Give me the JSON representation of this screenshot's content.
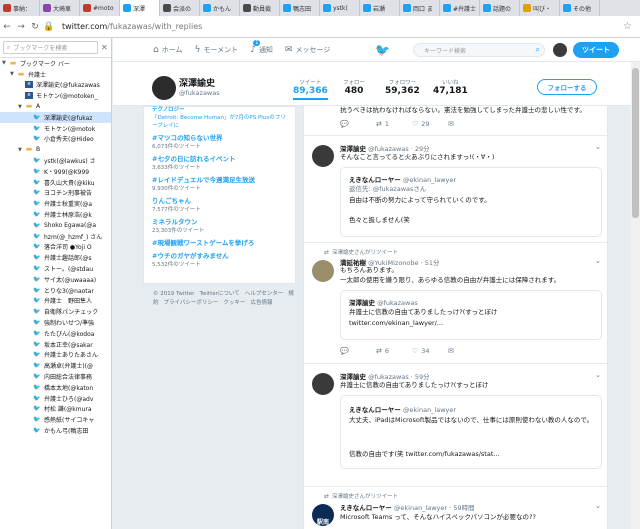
{
  "browser": {
    "tabs": [
      {
        "label": "事納：",
        "color": "#c0392b",
        "active": false
      },
      {
        "label": "大崎車",
        "color": "#8e44ad",
        "active": false
      },
      {
        "label": "#moto",
        "color": "#c0392b",
        "active": false
      },
      {
        "label": "深澤",
        "color": "#1da1f2",
        "active": true
      },
      {
        "label": "会派の",
        "color": "#4a4a4a",
        "active": false
      },
      {
        "label": "かもん",
        "color": "#1da1f2",
        "active": false
      },
      {
        "label": "動員裁",
        "color": "#4a4a4a",
        "active": false
      },
      {
        "label": "鴨志田",
        "color": "#1da1f2",
        "active": false
      },
      {
        "label": "ystk(",
        "color": "#1da1f2",
        "active": false
      },
      {
        "label": "岩瀬",
        "color": "#1da1f2",
        "active": false
      },
      {
        "label": "岡口 ま",
        "color": "#1da1f2",
        "active": false
      },
      {
        "label": "#弁護士",
        "color": "#1da1f2",
        "active": false
      },
      {
        "label": "話題の",
        "color": "#1da1f2",
        "active": false
      },
      {
        "label": "叫び・",
        "color": "#e0a000",
        "active": false
      },
      {
        "label": "その他",
        "color": "#1da1f2",
        "active": false
      }
    ],
    "url_domain": "twitter.com",
    "url_path": "/fukazawas/with_replies"
  },
  "sidebar": {
    "search_placeholder": "ブックマークを検索",
    "items": [
      {
        "label": "ブックマーク バー",
        "type": "folder",
        "indent": 0,
        "exp": "▼"
      },
      {
        "label": "弁護士",
        "type": "folder",
        "indent": 1,
        "exp": "▼"
      },
      {
        "label": "深澤諭史(@fukazawas",
        "type": "e",
        "indent": 2,
        "exp": ""
      },
      {
        "label": "モトケン(@motoken_",
        "type": "e",
        "indent": 2,
        "exp": ""
      },
      {
        "label": "A",
        "type": "folder",
        "indent": 2,
        "exp": "▼"
      },
      {
        "label": "深澤諭史(@fukaz",
        "type": "bird",
        "indent": 3,
        "exp": "",
        "selected": true
      },
      {
        "label": "モトケン(@motok",
        "type": "bird",
        "indent": 3,
        "exp": ""
      },
      {
        "label": "小倉秀夫(@Hideo",
        "type": "bird",
        "indent": 3,
        "exp": ""
      },
      {
        "label": "B",
        "type": "folder",
        "indent": 2,
        "exp": "▼"
      },
      {
        "label": "ystk(@lawkus) さ",
        "type": "bird",
        "indent": 3,
        "exp": ""
      },
      {
        "label": "K・999(@K999",
        "type": "bird",
        "indent": 3,
        "exp": ""
      },
      {
        "label": "喜久山大貴(@kiku",
        "type": "bird",
        "indent": 3,
        "exp": ""
      },
      {
        "label": "ヨコチン刑事被告",
        "type": "bird",
        "indent": 3,
        "exp": ""
      },
      {
        "label": "弁護士秋重実(@a",
        "type": "bird",
        "indent": 3,
        "exp": ""
      },
      {
        "label": "弁護士林原浩(@k",
        "type": "bird",
        "indent": 3,
        "exp": ""
      },
      {
        "label": "Shoko Egawa(@a",
        "type": "bird",
        "indent": 3,
        "exp": ""
      },
      {
        "label": "hzm(@_hzmf_) さん",
        "type": "bird",
        "indent": 3,
        "exp": ""
      },
      {
        "label": "落合洋司 ●Yoji O",
        "type": "bird",
        "indent": 3,
        "exp": ""
      },
      {
        "label": "弁護士趣話郎(@s",
        "type": "bird",
        "indent": 3,
        "exp": ""
      },
      {
        "label": "ストー。(@stdau",
        "type": "bird",
        "indent": 3,
        "exp": ""
      },
      {
        "label": "サイ太(@uwaaaa)",
        "type": "bird",
        "indent": 3,
        "exp": ""
      },
      {
        "label": "とりな3(@naotar",
        "type": "bird",
        "indent": 3,
        "exp": ""
      },
      {
        "label": "弁護士　野田隼人",
        "type": "bird",
        "indent": 3,
        "exp": ""
      },
      {
        "label": "自衛隊パンチェック",
        "type": "bird",
        "indent": 3,
        "exp": ""
      },
      {
        "label": "強制わいせつ/準強",
        "type": "bird",
        "indent": 3,
        "exp": ""
      },
      {
        "label": "たたびん(@kodoa",
        "type": "bird",
        "indent": 3,
        "exp": ""
      },
      {
        "label": "坂本正幸(@sakar",
        "type": "bird",
        "indent": 3,
        "exp": ""
      },
      {
        "label": "弁護士ありたあさん",
        "type": "bird",
        "indent": 3,
        "exp": ""
      },
      {
        "label": "高瀬卓(弁護士)(@",
        "type": "bird",
        "indent": 3,
        "exp": ""
      },
      {
        "label": "内田総合法律事務",
        "type": "bird",
        "indent": 3,
        "exp": ""
      },
      {
        "label": "橋本太地(@katon",
        "type": "bird",
        "indent": 3,
        "exp": ""
      },
      {
        "label": "弁護士ひろ(@adv",
        "type": "bird",
        "indent": 3,
        "exp": ""
      },
      {
        "label": "村松 謙(@kmura",
        "type": "bird",
        "indent": 3,
        "exp": ""
      },
      {
        "label": "感熱紙(サイコキャ",
        "type": "bird",
        "indent": 3,
        "exp": ""
      },
      {
        "label": "かもん弓(鴨志田",
        "type": "bird",
        "indent": 3,
        "exp": ""
      }
    ]
  },
  "twitter_nav": {
    "home": "ホーム",
    "moments": "モーメント",
    "notifications": "通知",
    "notif_badge": "1",
    "messages": "メッセージ",
    "search_placeholder": "キーワード検索",
    "tweet_button": "ツイート"
  },
  "profile": {
    "name": "深澤諭史",
    "handle": "@fukazawas",
    "stats": [
      {
        "label": "ツイート",
        "value": "89,366",
        "active": true
      },
      {
        "label": "フォロー",
        "value": "480",
        "active": false
      },
      {
        "label": "フォロワー",
        "value": "59,362",
        "active": false
      },
      {
        "label": "いいね",
        "value": "47,181",
        "active": false
      }
    ],
    "follow_button": "フォローする"
  },
  "trends": [
    {
      "name": "「Detroit: Become Human」が7月のPS Plusのフリープレイに",
      "desc": "",
      "count": "",
      "partial_top": true
    },
    {
      "name": "#マツコの知らない世界",
      "desc": "",
      "count": "6,073件のツイート"
    },
    {
      "name": "#七夕の日に訪れるイベント",
      "desc": "",
      "count": "3,633件のツイート"
    },
    {
      "name": "#レイドデュエルで今週満足生放送",
      "desc": "",
      "count": "9,930件のツイート"
    },
    {
      "name": "りんごちゃん",
      "desc": "",
      "count": "7,577件のツイート"
    },
    {
      "name": "ミネラルタウン",
      "desc": "",
      "count": "23,303件のツイート"
    },
    {
      "name": "#現場観戦ワーストゲームを挙げろ",
      "desc": "",
      "count": ""
    },
    {
      "name": "#ウチのガヤがすみません",
      "desc": "",
      "count": "5,532件のツイート"
    }
  ],
  "trend_header_partial": "テクノロジー",
  "footer": {
    "links": [
      "© 2019 Twitter",
      "Twitterについて",
      "ヘルプセンター",
      "規約",
      "プライバシーポリシー",
      "クッキー",
      "広告情報"
    ]
  },
  "timeline": {
    "top_partial_text": "抗うべきは抗わなければならない。憲法を勉強してしまった弁護士の悲しい性です。",
    "top_partial_actions": {
      "reply": "",
      "rt": "1",
      "like": "29"
    },
    "t1": {
      "name": "深澤諭史",
      "handle": "@fukazawas",
      "time": "· 29分",
      "text": "そんなこと言ってると火あぶりにされますっ!(・∀・)",
      "quote_name": "えきなんローヤー",
      "quote_handle": "@ekinan_lawyer",
      "quote_reply": "返信先: @fukazawasさん",
      "quote_line1": "自由は不断の努力によって守られていくのです。",
      "quote_line2": "色々と扱しません(笑"
    },
    "rt1_label": "深澤諭史さんがリツイート",
    "t2": {
      "name": "満延祐樹",
      "handle": "@YukiMizonobe",
      "time": "· 51分",
      "line1": "もちろんあります。",
      "line2": "一太郎の使用を嫌う限り、あらゆる信教の自由が弁護士には保障されます。",
      "quote_name": "深澤諭史",
      "quote_handle": "@fukazawas",
      "quote_line1": "弁護士に信教の自由てありましたっけ?(すっとぼけ",
      "quote_line2": "twitter.com/ekinan_lawyer/...",
      "actions": {
        "reply": "",
        "rt": "6",
        "like": "34"
      }
    },
    "t3": {
      "name": "深澤諭史",
      "handle": "@fukazawas",
      "time": "· 59分",
      "text": "弁護士に信教の自由てありましたっけ?(すっとぼけ",
      "quote_name": "えきなんローヤー",
      "quote_handle": "@ekinan_lawyer",
      "quote_line1": "大丈夫、iPadはMicrosoft製品ではないので、仕事には原則使わない教の人なので。",
      "quote_line2": "信教の自由です(笑 twitter.com/fukazawas/stat..."
    },
    "rt2_label": "深澤諭史さんがリツイート",
    "t4": {
      "name": "えきなんローヤー",
      "handle": "@ekinan_lawyer",
      "time": "· 59時間",
      "text": "Microsoft Teams って、そんなハイスペックパソコンが必要なの??",
      "avatar_text": "駅南"
    }
  }
}
